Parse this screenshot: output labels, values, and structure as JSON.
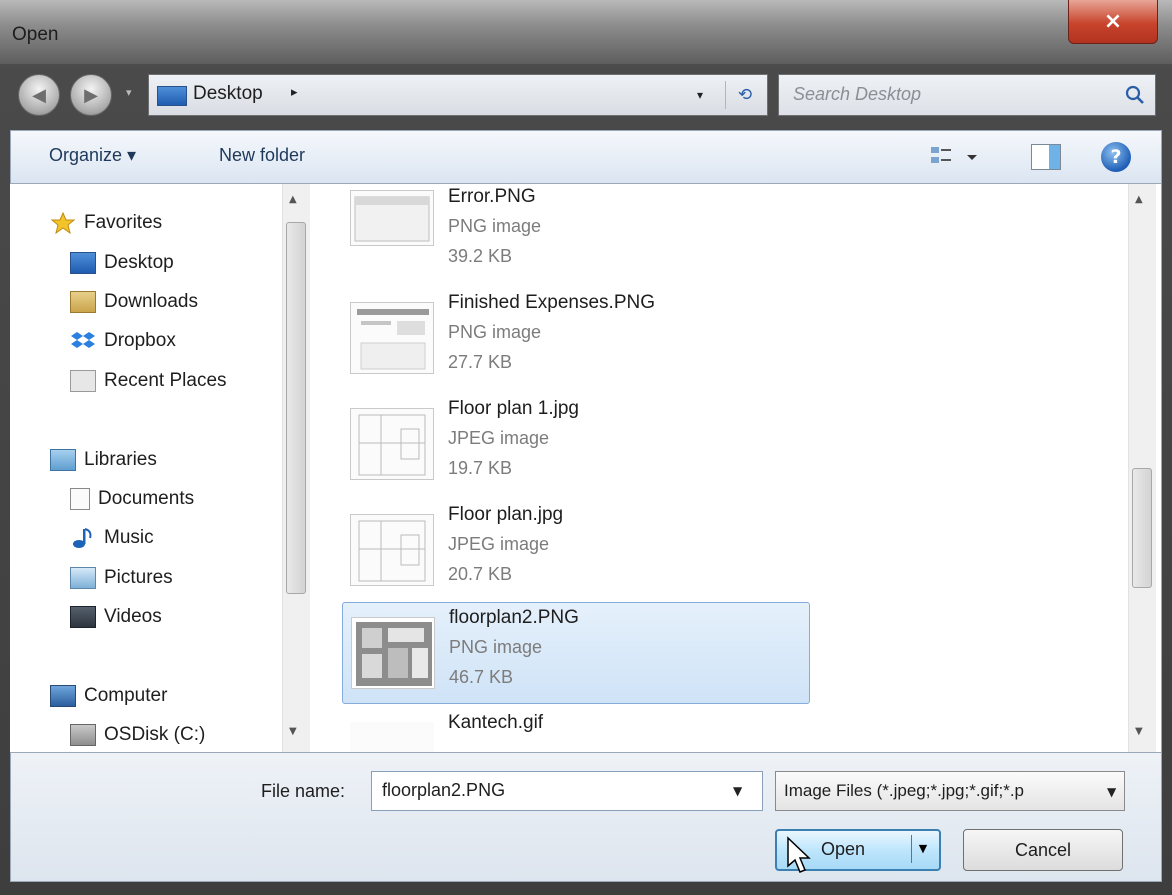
{
  "window": {
    "title": "Open",
    "close_symbol": "×"
  },
  "address_bar": {
    "location": "Desktop",
    "arrow": "▸",
    "dropdown": "▾",
    "refresh_symbol": "⟲"
  },
  "search": {
    "placeholder": "Search Desktop"
  },
  "toolbar": {
    "organize_label": "Organize ▾",
    "new_folder_label": "New folder",
    "help_symbol": "?"
  },
  "navigation": {
    "items": [
      {
        "label": "Favorites",
        "icon": "star-icon"
      },
      {
        "label": "Desktop",
        "icon": "desktop-icon"
      },
      {
        "label": "Downloads",
        "icon": "downloads-icon"
      },
      {
        "label": "Dropbox",
        "icon": "dropbox-icon"
      },
      {
        "label": "Recent Places",
        "icon": "recent-places-icon"
      },
      {
        "label": "Libraries",
        "icon": "libraries-icon"
      },
      {
        "label": "Documents",
        "icon": "documents-icon"
      },
      {
        "label": "Music",
        "icon": "music-icon"
      },
      {
        "label": "Pictures",
        "icon": "pictures-icon"
      },
      {
        "label": "Videos",
        "icon": "videos-icon"
      },
      {
        "label": "Computer",
        "icon": "computer-icon"
      },
      {
        "label": "OSDisk (C:)",
        "icon": "disk-icon"
      }
    ]
  },
  "files": [
    {
      "name": "Error.PNG",
      "type": "PNG image",
      "size": "39.2 KB",
      "selected": false
    },
    {
      "name": "Finished Expenses.PNG",
      "type": "PNG image",
      "size": "27.7 KB",
      "selected": false
    },
    {
      "name": "Floor plan 1.jpg",
      "type": "JPEG image",
      "size": "19.7 KB",
      "selected": false
    },
    {
      "name": "Floor plan.jpg",
      "type": "JPEG image",
      "size": "20.7 KB",
      "selected": false
    },
    {
      "name": "floorplan2.PNG",
      "type": "PNG image",
      "size": "46.7 KB",
      "selected": true
    },
    {
      "name": "Kantech.gif",
      "type": "",
      "size": "",
      "selected": false
    }
  ],
  "bottom": {
    "file_name_label": "File name:",
    "file_name_value": "floorplan2.PNG",
    "filter_value": "Image Files (*.jpeg;*.jpg;*.gif;*.p",
    "open_label": "Open",
    "cancel_label": "Cancel"
  },
  "colors": {
    "selection": "#cfe3f7",
    "selection_border": "#84acdd",
    "accent": "#3c7fb1"
  }
}
